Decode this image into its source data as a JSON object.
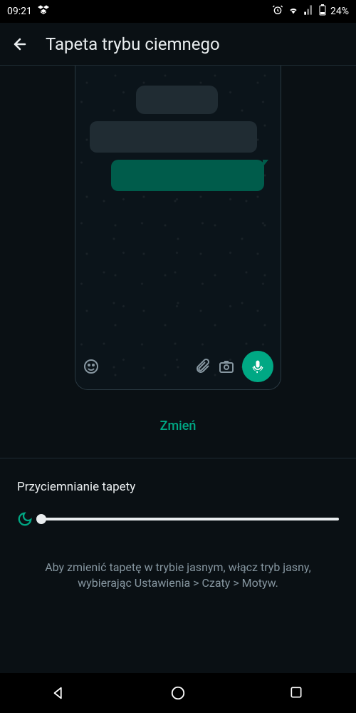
{
  "status": {
    "time": "09:21",
    "battery_pct": "24%"
  },
  "header": {
    "title": "Tapeta trybu ciemnego"
  },
  "actions": {
    "change_label": "Zmień"
  },
  "dimming": {
    "label": "Przyciemnianie tapety"
  },
  "hint": {
    "text": "Aby zmienić tapetę w trybie jasnym, włącz tryb jasny, wybierając Ustawienia > Czaty > Motyw."
  }
}
